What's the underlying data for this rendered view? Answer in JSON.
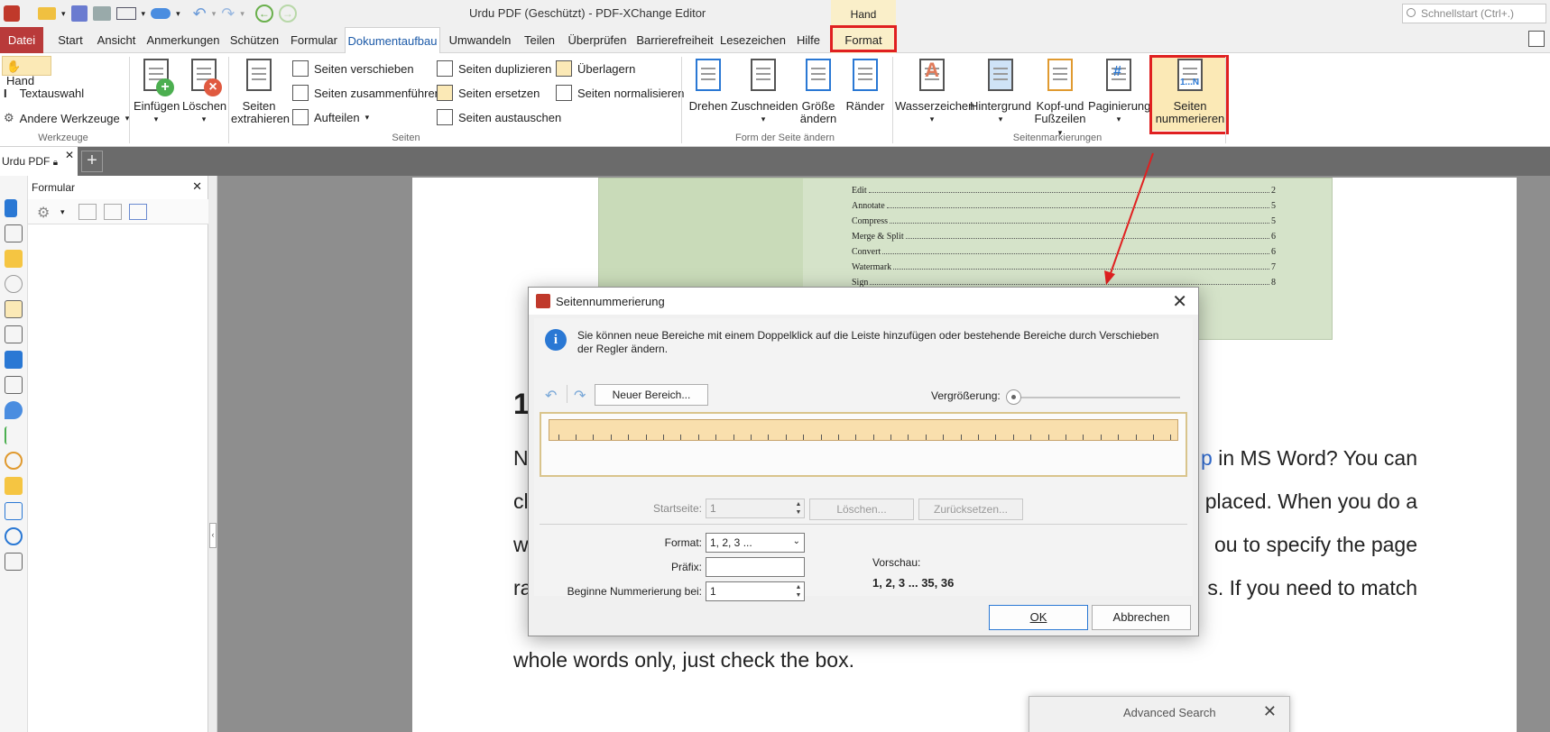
{
  "window": {
    "title": "Urdu PDF (Geschützt) - PDF-XChange Editor",
    "context_tab_group": "Hand",
    "search_placeholder": "Schnellstart (Ctrl+.)"
  },
  "tabs": [
    {
      "label": "Datei"
    },
    {
      "label": "Start"
    },
    {
      "label": "Ansicht"
    },
    {
      "label": "Anmerkungen"
    },
    {
      "label": "Schützen"
    },
    {
      "label": "Formular"
    },
    {
      "label": "Dokumentaufbau"
    },
    {
      "label": "Umwandeln"
    },
    {
      "label": "Teilen"
    },
    {
      "label": "Überprüfen"
    },
    {
      "label": "Barrierefreiheit"
    },
    {
      "label": "Lesezeichen"
    },
    {
      "label": "Hilfe"
    },
    {
      "label": "Format"
    }
  ],
  "ribbon": {
    "werkzeuge": {
      "hand": "Hand",
      "textauswahl": "Textauswahl",
      "andere": "Andere Werkzeuge",
      "group": "Werkzeuge"
    },
    "seiten": {
      "einfuegen": "Einfügen",
      "loeschen": "Löschen",
      "extrahieren_1": "Seiten",
      "extrahieren_2": "extrahieren",
      "verschieben": "Seiten verschieben",
      "zusammenfuehren": "Seiten zusammenführen",
      "aufteilen": "Aufteilen",
      "duplizieren": "Seiten duplizieren",
      "ersetzen": "Seiten ersetzen",
      "austauschen": "Seiten austauschen",
      "ueberlagern": "Überlagern",
      "normalisieren": "Seiten normalisieren",
      "group": "Seiten"
    },
    "form": {
      "drehen": "Drehen",
      "zuschneiden": "Zuschneiden",
      "groesse_1": "Größe",
      "groesse_2": "ändern",
      "raender": "Ränder",
      "group": "Form der Seite ändern"
    },
    "markierungen": {
      "wasserzeichen": "Wasserzeichen",
      "hintergrund": "Hintergrund",
      "kopf_1": "Kopf-und",
      "kopf_2": "Fußzeilen",
      "paginierung": "Paginierung",
      "nummerieren_1": "Seiten",
      "nummerieren_2": "nummerieren",
      "nummerieren_icon_text": "1...N",
      "group": "Seitenmarkierungen"
    }
  },
  "doc_tab": {
    "label": "Urdu PDF"
  },
  "panel": {
    "title": "Formular"
  },
  "document": {
    "toc": [
      {
        "label": "Edit",
        "page": "2"
      },
      {
        "label": "Annotate",
        "page": "5"
      },
      {
        "label": "Compress",
        "page": "5"
      },
      {
        "label": "Merge & Split",
        "page": "6"
      },
      {
        "label": "Convert",
        "page": "6"
      },
      {
        "label": "Watermark",
        "page": "7"
      },
      {
        "label": "Sign",
        "page": "8"
      }
    ],
    "heading_fragment": "1",
    "lines": [
      {
        "left": "N",
        "right_link": "p",
        "right": " in MS Word? You can"
      },
      {
        "left": "cl",
        "right": "placed. When you do a"
      },
      {
        "left": "w",
        "right": "ou to specify the page"
      },
      {
        "left": "ra",
        "right": "s. If you need to match"
      }
    ],
    "last_line": "whole words only, just check the box."
  },
  "advanced_search": {
    "title": "Advanced Search"
  },
  "dialog": {
    "title": "Seitennummerierung",
    "info": "Sie können neue Bereiche mit einem Doppelklick auf die Leiste hinzufügen oder bestehende Bereiche durch Verschieben der Regler ändern.",
    "new_range": "Neuer Bereich...",
    "zoom_label": "Vergrößerung:",
    "startseite_label": "Startseite:",
    "startseite_value": "1",
    "loeschen": "Löschen...",
    "zuruecksetzen": "Zurücksetzen...",
    "format_label": "Format:",
    "format_value": "1, 2, 3 ...",
    "praefix_label": "Präfix:",
    "praefix_value": "",
    "beginne_label": "Beginne Nummerierung bei:",
    "beginne_value": "1",
    "vorschau_label": "Vorschau:",
    "vorschau_value": "1, 2, 3 ... 35, 36",
    "ok": "OK",
    "abbrechen": "Abbrechen"
  },
  "colors": {
    "file_tab": "#b93a3a",
    "context_tab": "#faefc9",
    "highlight_box": "#e02020",
    "range_bar": "#f9dfad",
    "toc_bg": "#d5e3c9"
  }
}
